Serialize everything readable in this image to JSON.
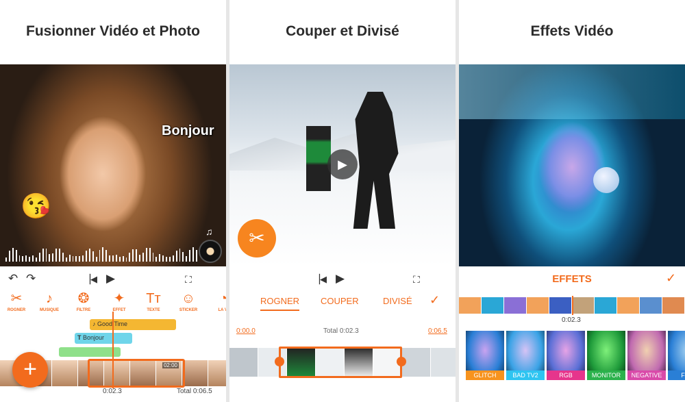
{
  "panel1": {
    "title": "Fusionner Vidéo et Photo",
    "overlay_text": "Bonjour",
    "emoji": "😘",
    "music_note": "♫",
    "tools": [
      {
        "label": "ROGNER",
        "icon": "✂"
      },
      {
        "label": "MUSIQUE",
        "icon": "♪"
      },
      {
        "label": "FILTRE",
        "icon": "❂"
      },
      {
        "label": "EFFET",
        "icon": "✦"
      },
      {
        "label": "TEXTE",
        "icon": "Tт"
      },
      {
        "label": "STICKER",
        "icon": "☺"
      },
      {
        "label": "LA VI",
        "icon": "◔"
      }
    ],
    "music_track": "Good Time",
    "text_track": "Bonjour",
    "clip_duration": "02:00",
    "current_time": "0:02.3",
    "total": "Total 0:06.5",
    "fab": "+"
  },
  "panel2": {
    "title": "Couper et Divisé",
    "tabs": [
      "ROGNER",
      "COUPER",
      "DIVISÉ"
    ],
    "start_time": "0:00.0",
    "total": "Total 0:02.3",
    "end_time": "0:06.5"
  },
  "panel3": {
    "title": "Effets Vidéo",
    "effects_title": "EFFETS",
    "current_time": "0:02.3",
    "effects": [
      "GLITCH",
      "BAD TV2",
      "RGB",
      "MONITOR",
      "NEGATIVE",
      "FLO"
    ],
    "colors": {
      "glitch": "#f7931e",
      "badtv": "#2ec4f1",
      "rgb": "#e6358c",
      "monitor": "#2bb24c",
      "negative": "#d94aa9",
      "flo": "#2a7fd6"
    }
  }
}
